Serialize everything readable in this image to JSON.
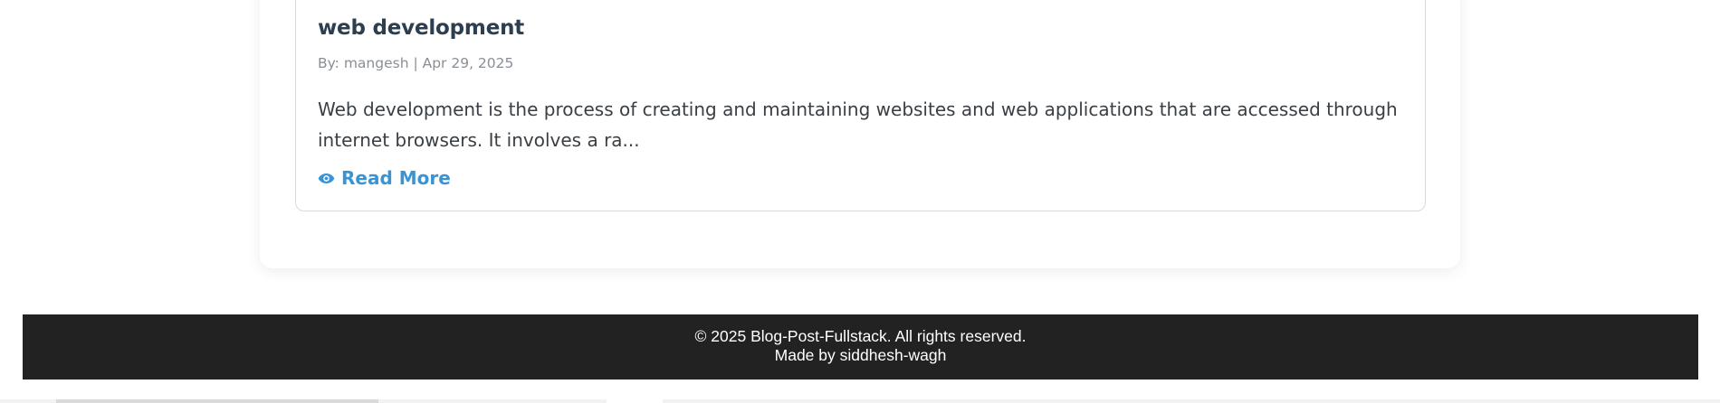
{
  "post": {
    "title": "web development",
    "meta": "By: mangesh | Apr 29, 2025",
    "excerpt": "Web development is the process of creating and maintaining websites and web applications that are accessed through internet browsers. It involves a ra...",
    "read_more_label": "Read More",
    "read_more_icon": "eye-icon"
  },
  "footer": {
    "copyright": "© 2025 Blog-Post-Fullstack. All rights reserved.",
    "credit": "Made by siddhesh-wagh"
  },
  "colors": {
    "title": "#2c3e50",
    "accent": "#3a94d3",
    "footer_bg": "#222222"
  }
}
